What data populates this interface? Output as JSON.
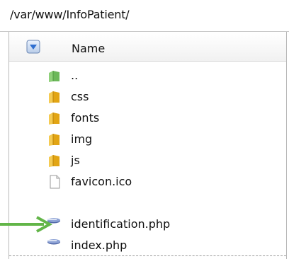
{
  "path": "/var/www/InfoPatient/",
  "header": {
    "name_label": "Name"
  },
  "rows": [
    {
      "name": "..",
      "type": "parent-folder"
    },
    {
      "name": "css",
      "type": "folder"
    },
    {
      "name": "fonts",
      "type": "folder"
    },
    {
      "name": "img",
      "type": "folder"
    },
    {
      "name": "js",
      "type": "folder"
    },
    {
      "name": "favicon.ico",
      "type": "file"
    },
    {
      "name": "identification.php",
      "type": "php"
    },
    {
      "name": "index.php",
      "type": "php"
    }
  ],
  "colors": {
    "folder": "#e8b21c",
    "parent_folder": "#7cc06a",
    "arrow": "#62b548",
    "php": "#5a6fa8"
  },
  "icons": {
    "sort": "sort-down-icon",
    "folder": "folder-icon",
    "parent_folder": "parent-folder-icon",
    "file": "file-icon",
    "php": "php-file-icon",
    "arrow": "arrow-right-icon"
  }
}
